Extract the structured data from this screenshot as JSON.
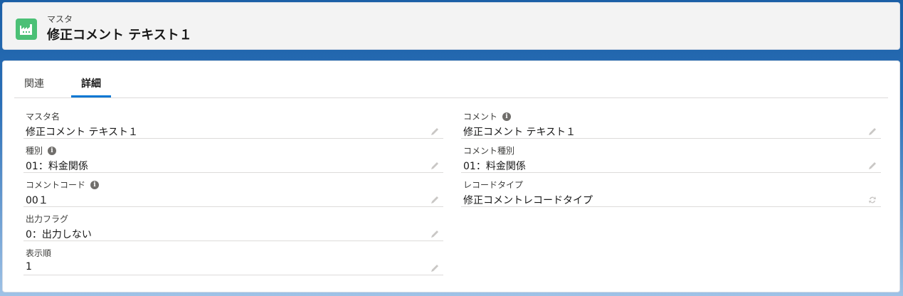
{
  "header": {
    "object_type": "マスタ",
    "title": "修正コメント テキスト１",
    "icon": "factory-icon",
    "icon_color": "#4bc076"
  },
  "tabs": [
    {
      "label": "関連",
      "active": false
    },
    {
      "label": "詳細",
      "active": true
    }
  ],
  "accent_color": "#0176d3",
  "left_fields": [
    {
      "label": "マスタ名",
      "value": "修正コメント テキスト１",
      "info": false
    },
    {
      "label": "種別",
      "value": "01：料金関係",
      "info": true
    },
    {
      "label": "コメントコード",
      "value": "00１",
      "info": true
    },
    {
      "label": "出力フラグ",
      "value": "0：出力しない",
      "info": false
    },
    {
      "label": "表示順",
      "value": "1",
      "info": false
    }
  ],
  "right_fields": [
    {
      "label": "コメント",
      "value": "修正コメント テキスト１",
      "info": true
    },
    {
      "label": "コメント種別",
      "value": "01：料金関係",
      "info": false
    },
    {
      "label": "レコードタイプ",
      "value": "修正コメントレコードタイプ",
      "info": false
    }
  ]
}
